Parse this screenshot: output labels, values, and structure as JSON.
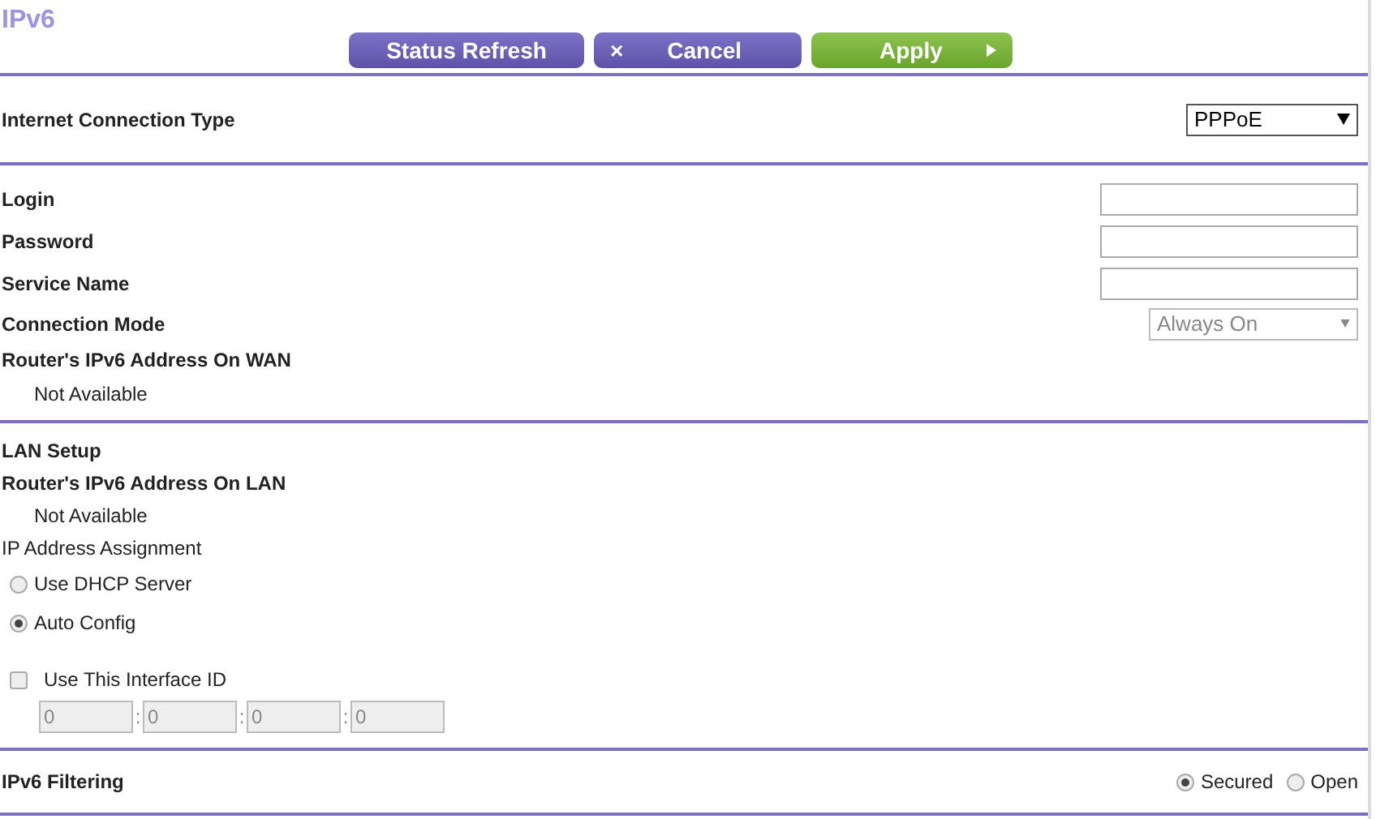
{
  "title": "IPv6",
  "buttons": [
    {
      "kind": "refresh",
      "label": "Status Refresh"
    },
    {
      "kind": "cancel",
      "label": "Cancel",
      "icon": "×"
    },
    {
      "kind": "apply",
      "label": "Apply"
    }
  ],
  "connection_type": {
    "label": "Internet Connection Type",
    "value": "PPPoE"
  },
  "wan_fields": [
    {
      "kind": "text",
      "label": "Login"
    },
    {
      "kind": "text",
      "label": "Password"
    },
    {
      "kind": "text",
      "label": "Service Name"
    },
    {
      "kind": "select",
      "label": "Connection Mode",
      "value": "Always On",
      "disabled": true
    }
  ],
  "wan_address": {
    "label": "Router's IPv6 Address On WAN",
    "value": "Not Available"
  },
  "lan": {
    "heading": "LAN Setup",
    "address_label": "Router's IPv6 Address On LAN",
    "address_value": "Not Available",
    "assignment_label": "IP Address Assignment",
    "options": [
      {
        "label": "Use DHCP Server",
        "selected": false
      },
      {
        "label": "Auto Config",
        "selected": true
      }
    ],
    "interface_id": {
      "label": "Use This Interface ID",
      "checked": false,
      "separator": ":",
      "parts": [
        "0",
        "0",
        "0",
        "0"
      ],
      "disabled": true
    }
  },
  "filtering": {
    "label": "IPv6 Filtering",
    "options": [
      {
        "label": "Secured",
        "selected": true
      },
      {
        "label": "Open",
        "selected": false
      }
    ]
  }
}
